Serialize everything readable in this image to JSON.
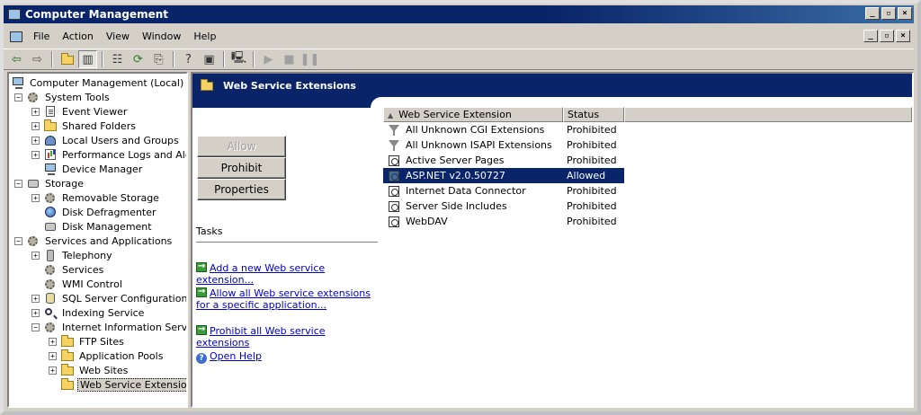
{
  "window": {
    "title": "Computer Management"
  },
  "menu": {
    "items": [
      {
        "label": "File",
        "key": "F"
      },
      {
        "label": "Action",
        "key": "A"
      },
      {
        "label": "View",
        "key": "V"
      },
      {
        "label": "Window",
        "key": "W"
      },
      {
        "label": "Help",
        "key": "H"
      }
    ]
  },
  "toolbar": {
    "icons": [
      "back-arrow-icon",
      "forward-arrow-icon",
      "up-folder-icon",
      "show-hide-tree-icon",
      "properties-icon",
      "refresh-icon",
      "export-list-icon",
      "help-icon",
      "action-pane-icon",
      "connect-computer-icon",
      "play-icon",
      "stop-icon",
      "pause-icon"
    ]
  },
  "tree": {
    "root": "Computer Management (Local)",
    "items": [
      {
        "label": "System Tools"
      },
      {
        "label": "Event Viewer"
      },
      {
        "label": "Shared Folders"
      },
      {
        "label": "Local Users and Groups"
      },
      {
        "label": "Performance Logs and Alerts"
      },
      {
        "label": "Device Manager"
      },
      {
        "label": "Storage"
      },
      {
        "label": "Removable Storage"
      },
      {
        "label": "Disk Defragmenter"
      },
      {
        "label": "Disk Management"
      },
      {
        "label": "Services and Applications"
      },
      {
        "label": "Telephony"
      },
      {
        "label": "Services"
      },
      {
        "label": "WMI Control"
      },
      {
        "label": "SQL Server Configuration Manager"
      },
      {
        "label": "Indexing Service"
      },
      {
        "label": "Internet Information Services"
      },
      {
        "label": "FTP Sites"
      },
      {
        "label": "Application Pools"
      },
      {
        "label": "Web Sites"
      },
      {
        "label": "Web Service Extensions"
      }
    ]
  },
  "panel": {
    "title": "Web Service Extensions",
    "buttons": {
      "allow": "Allow",
      "prohibit": "Prohibit",
      "properties": "Properties"
    },
    "tasks_label": "Tasks",
    "tasks": [
      "Add a new Web service extension...",
      "Allow all Web service extensions for a specific application...",
      "Prohibit all Web service extensions",
      "Open Help"
    ]
  },
  "list": {
    "columns": {
      "extension": "Web Service Extension",
      "status": "Status"
    },
    "rows": [
      {
        "name": "All Unknown CGI Extensions",
        "status": "Prohibited"
      },
      {
        "name": "All Unknown ISAPI Extensions",
        "status": "Prohibited"
      },
      {
        "name": "Active Server Pages",
        "status": "Prohibited"
      },
      {
        "name": "ASP.NET v2.0.50727",
        "status": "Allowed"
      },
      {
        "name": "Internet Data Connector",
        "status": "Prohibited"
      },
      {
        "name": "Server Side Includes",
        "status": "Prohibited"
      },
      {
        "name": "WebDAV",
        "status": "Prohibited"
      }
    ]
  },
  "colors": {
    "titlebar": "#0a246a",
    "face": "#d4d0c8",
    "link": "#0000cc"
  }
}
